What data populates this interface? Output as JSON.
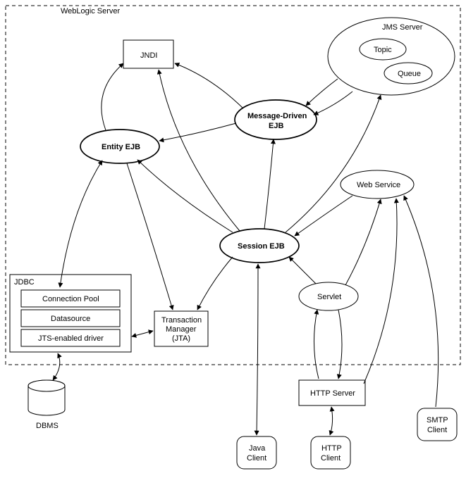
{
  "container": {
    "label": "WebLogic Server"
  },
  "jdbc": {
    "label": "JDBC",
    "items": [
      "Connection Pool",
      "Datasource",
      "JTS-enabled driver"
    ]
  },
  "jms": {
    "label": "JMS Server",
    "topic": "Topic",
    "queue": "Queue"
  },
  "nodes": {
    "jndi": "JNDI",
    "entity_ejb": "Entity EJB",
    "message_driven_ejb": {
      "line1": "Message-Driven",
      "line2": "EJB"
    },
    "session_ejb": "Session EJB",
    "web_service": "Web Service",
    "servlet": "Servlet",
    "txn_mgr": {
      "line1": "Transaction",
      "line2": "Manager",
      "line3": "(JTA)"
    },
    "http_server": "HTTP Server",
    "dbms": "DBMS",
    "java_client": {
      "line1": "Java",
      "line2": "Client"
    },
    "http_client": {
      "line1": "HTTP",
      "line2": "Client"
    },
    "smtp_client": {
      "line1": "SMTP",
      "line2": "Client"
    }
  }
}
